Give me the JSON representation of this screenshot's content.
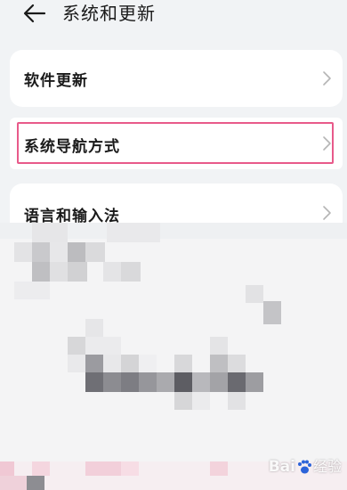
{
  "header": {
    "title": "系统和更新"
  },
  "items": [
    {
      "label": "软件更新"
    },
    {
      "label": "系统导航方式"
    },
    {
      "label": "语言和输入法"
    }
  ],
  "watermark": {
    "brand_prefix": "Bai",
    "brand_suffix": "经验"
  },
  "colors": {
    "background": "#f1f3f5",
    "card": "#ffffff",
    "highlight": "#e85a8a"
  }
}
